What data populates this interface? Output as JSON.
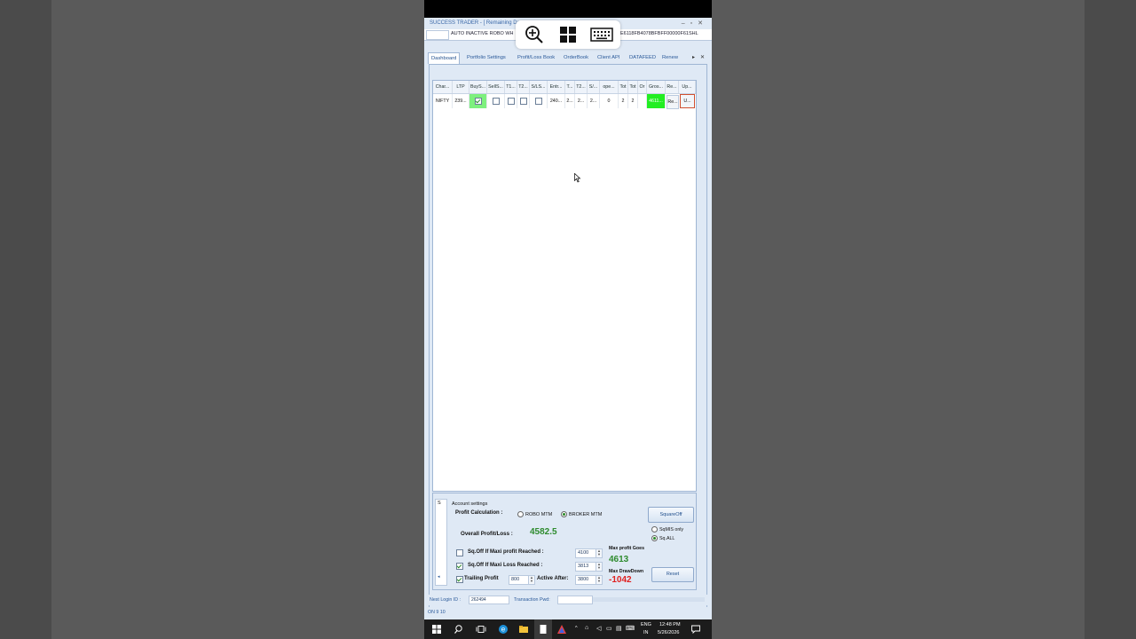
{
  "window": {
    "title": "SUCCESS TRADER - [ Remaining Days",
    "auto_text": "AUTO INACTIVE ROBO WH",
    "key_text": "E6118FB4078BFBFF00000F61SHL"
  },
  "overlay_icons": [
    "zoom-in-icon",
    "windows-icon",
    "keyboard-icon"
  ],
  "tabs": [
    "Dashboard",
    "Portfolio Settings",
    "Profit/Loss Book",
    "OrderBook",
    "Client API",
    "DATAFEED",
    "Renew"
  ],
  "grid": {
    "headers": [
      "Char...",
      "LTP",
      "BuyS...",
      "SellS...",
      "T1...",
      "T2...",
      "S/LS...",
      "Entr...",
      "T...",
      "T2...",
      "S/...",
      "ope...",
      "Tot",
      "Tot",
      "Or",
      "Gros...",
      "Re...",
      "Up..."
    ],
    "row": {
      "symbol": "NIFTY",
      "ltp": "239...",
      "entry": "240...",
      "t": "2...",
      "t2": "2...",
      "s": "2...",
      "open": "0",
      "tot1": "2",
      "tot2": "2",
      "gross": "4611...",
      "re": "Re...",
      "up": "U..."
    }
  },
  "account": {
    "side_label": "S",
    "title": "Account settings",
    "profit_calc_label": "Profit Calculation  :",
    "robo_mtm": "ROBO MTM",
    "broker_mtm": "BROKER MTM",
    "squareoff_btn": "SquareOff",
    "sqmis_only": "SqMIS only",
    "sq_all": "Sq.ALL",
    "overall_label": "Overall Profit/Loss  :",
    "overall_value": "4582.5",
    "maxi_profit_label": "Sq.Off If Maxi profit Reached :",
    "maxi_profit_value": "4100",
    "maxi_loss_label": "Sq.Off If Maxi Loss Reached :",
    "maxi_loss_value": "3813",
    "trailing_label": "Trailing Profit",
    "trailing_value": "800",
    "active_after_label": "Active After:",
    "active_after_value": "3800",
    "max_profit_goes_label": "Max profit Goes",
    "max_profit_goes_value": "4613",
    "max_drawdown_label": "Max DrawDown",
    "max_drawdown_value": "-1042",
    "reset_btn": "Reset"
  },
  "status": {
    "nest_login_label": "Nest Login ID :",
    "nest_login_value": "262494",
    "transaction_pwd_label": "Transaction Pwd:",
    "bottom_text": "ON  9  10"
  },
  "taskbar": {
    "lang": "ENG",
    "region": "IN",
    "time": "12:48 PM",
    "date": "5/26/2026"
  },
  "colors": {
    "profit_green": "#2e8b2e",
    "loss_red": "#e02020",
    "highlight_green": "#22ee22",
    "accent_blue": "#2b5a9a"
  }
}
